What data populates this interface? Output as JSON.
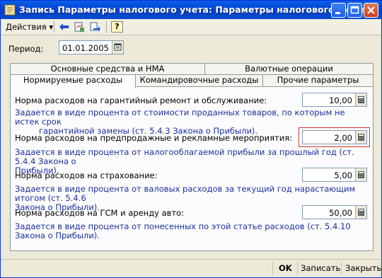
{
  "window": {
    "title": "Запись Параметры налогового учета: Параметры налогового учета:"
  },
  "toolbar": {
    "actions_label": "Действия",
    "actions_arrow": "▾",
    "help_label": "?"
  },
  "period": {
    "label": "Период:",
    "value": "01.01.2005"
  },
  "tabs": {
    "top": [
      "Основные средства и НМА",
      "Валютные операции"
    ],
    "bottom": [
      "Нормируемые расходы",
      "Командировочные расходы",
      "Прочие параметры"
    ]
  },
  "rows": [
    {
      "label": "Норма расходов на гарантийный ремонт и обслуживание:",
      "value": "10,00",
      "desc1": "Задается в виде процента от стоимости проданных товаров, по которым не истек срок",
      "desc2": "гарантийной замены (ст. 5.4.3 Закона о Прибыли)."
    },
    {
      "label": "Норма расходов на предпродажные и рекламные мероприятия:",
      "value": "2,00",
      "desc1": "Задается в виде процента от налогооблагаемой прибыли за прошлый год (ст. 5.4.4 Закона о",
      "desc2": "Прибыли)."
    },
    {
      "label": "Норма расходов на страхование:",
      "value": "5,00",
      "desc1": "Задается в виде процента от валовых расходов за текущий год нарастающим итогом (ст. 5.4.6",
      "desc2": "Закона о Прибыли)."
    },
    {
      "label": "Норма расходов на ГСМ и аренду авто:",
      "value": "50,00",
      "desc1": "Задается в виде процента от понесенных по этой статье расходов (ст. 5.4.10 Закона о Прибыли).",
      "desc2": ""
    }
  ],
  "buttons": {
    "ok": "OK",
    "save": "Записать",
    "close": "Закрыть"
  },
  "colors": {
    "title_bar": "#0054e3",
    "description_text": "#1a2f9c",
    "highlight_border": "#d2332b"
  }
}
